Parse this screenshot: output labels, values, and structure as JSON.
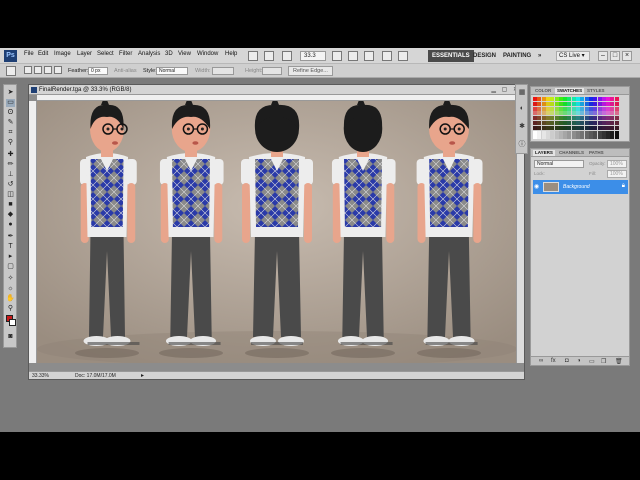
{
  "app": {
    "logo": "Ps",
    "zoom": "33.3",
    "workspace_active": "ESSENTIALS",
    "workspaces": [
      "DESIGN",
      "PAINTING"
    ],
    "more": "»",
    "cslive": "CS Live ▾"
  },
  "menu": [
    "File",
    "Edit",
    "Image",
    "Layer",
    "Select",
    "Filter",
    "Analysis",
    "3D",
    "View",
    "Window",
    "Help"
  ],
  "options": {
    "feather_label": "Feather:",
    "feather_value": "0 px",
    "antialias": "Anti-alias",
    "style_label": "Style:",
    "style_value": "Normal",
    "width_label": "Width:",
    "height_label": "Height:",
    "refine_edge": "Refine Edge..."
  },
  "document": {
    "title": "FinalRender.tga @ 33.3% (RGB/8)",
    "zoom_status": "33.33%",
    "doc_status": "Doc: 17.0M/17.0M"
  },
  "panels": {
    "color_tabs": [
      "COLOR",
      "SWATCHES",
      "STYLES"
    ],
    "color_active": 1,
    "layer_tabs": [
      "LAYERS",
      "CHANNELS",
      "PATHS"
    ],
    "blend_mode": "Normal",
    "opacity_label": "Opacity:",
    "opacity_value": "100%",
    "lock_label": "Lock:",
    "fill_label": "Fill:",
    "fill_value": "100%",
    "layer_name": "Background"
  },
  "window_buttons": [
    "–",
    "□",
    "×"
  ],
  "colors": {
    "accent": "#3c8ee8",
    "canvas_bg": "#b4a79a",
    "vest_blue": "#2a3aa8",
    "shirt": "#ededed",
    "pants": "#4a4a4a",
    "hair": "#1c1c1c",
    "skin": "#e8a58c"
  }
}
